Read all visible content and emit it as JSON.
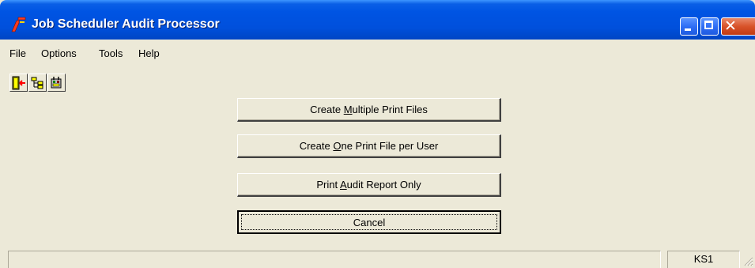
{
  "window": {
    "title": "Job Scheduler Audit Processor",
    "controls": {
      "minimize": "minimize",
      "maximize": "maximize",
      "close": "close"
    }
  },
  "menu": {
    "items": [
      {
        "label": "File"
      },
      {
        "label": "Options"
      },
      {
        "label": "Tools"
      },
      {
        "label": "Help"
      }
    ]
  },
  "toolbar": {
    "buttons": [
      {
        "icon": "exit-door-icon"
      },
      {
        "icon": "tree-structure-icon"
      },
      {
        "icon": "scheduler-tool-icon"
      }
    ]
  },
  "actions": {
    "multiple": {
      "pre": "Create ",
      "mnemonic": "M",
      "post": "ultiple Print Files"
    },
    "per_user": {
      "pre": "Create ",
      "mnemonic": "O",
      "post": "ne Print File per User"
    },
    "audit_only": {
      "pre": "Print ",
      "mnemonic": "A",
      "post": "udit Report Only"
    },
    "cancel": {
      "label": "Cancel"
    }
  },
  "status": {
    "main": "",
    "server": "KS1"
  },
  "colors": {
    "titlebar": "#0054e3",
    "face": "#ece9d8",
    "close_button": "#d8532a"
  }
}
